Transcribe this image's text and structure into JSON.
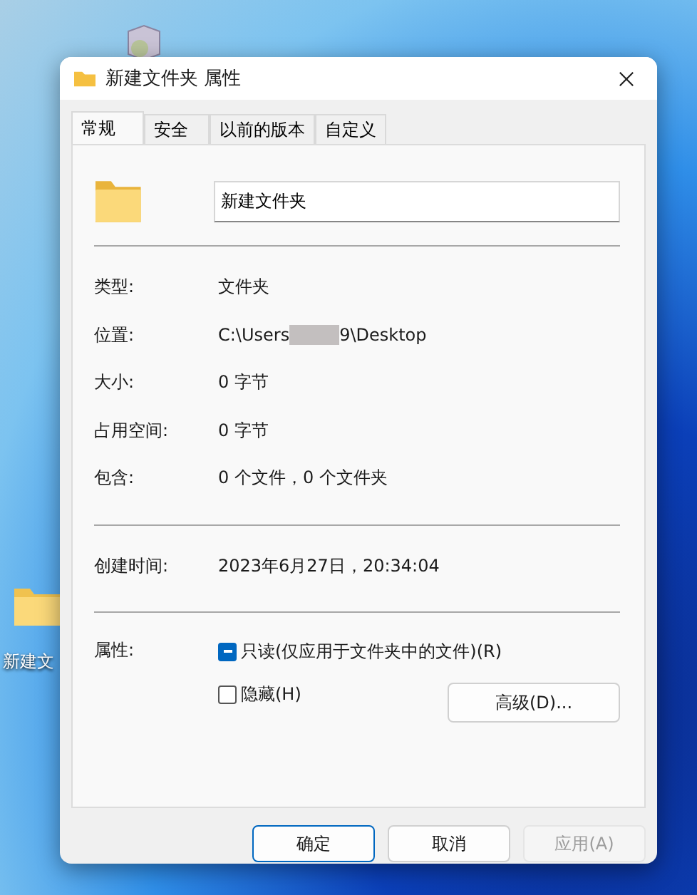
{
  "desktop": {
    "icons": [
      {
        "kind": "box"
      },
      {
        "kind": "folder",
        "label": "新建文"
      }
    ]
  },
  "window": {
    "title": "新建文件夹 属性"
  },
  "tabs": [
    {
      "label": "常规",
      "selected": true
    },
    {
      "label": "安全",
      "selected": false
    },
    {
      "label": "以前的版本",
      "selected": false
    },
    {
      "label": "自定义",
      "selected": false
    }
  ],
  "name_field": {
    "value": "新建文件夹"
  },
  "info": [
    {
      "label": "类型:",
      "value": "文件夹"
    },
    {
      "label": "位置:",
      "value": "C:\\Users",
      "redacted": true,
      "value_after": "9\\Desktop"
    },
    {
      "label": "大小:",
      "value": "0 字节"
    },
    {
      "label": "占用空间:",
      "value": "0 字节"
    },
    {
      "label": "包含:",
      "value": "0 个文件，0 个文件夹"
    }
  ],
  "dates": [
    {
      "label": "创建时间:",
      "value": "2023年6月27日，20:34:04"
    }
  ],
  "attributes": {
    "label": "属性:",
    "checkboxes": [
      {
        "label": "只读(仅应用于文件夹中的文件)(R)",
        "checked": true,
        "indeterminate": true
      },
      {
        "label": "隐藏(H)",
        "checked": false,
        "indeterminate": false
      }
    ],
    "advanced_button": "高级(D)..."
  },
  "buttons": [
    {
      "label": "确定",
      "default": true,
      "disabled": false
    },
    {
      "label": "取消",
      "default": false,
      "disabled": false
    },
    {
      "label": "应用(A)",
      "default": false,
      "disabled": true
    }
  ]
}
